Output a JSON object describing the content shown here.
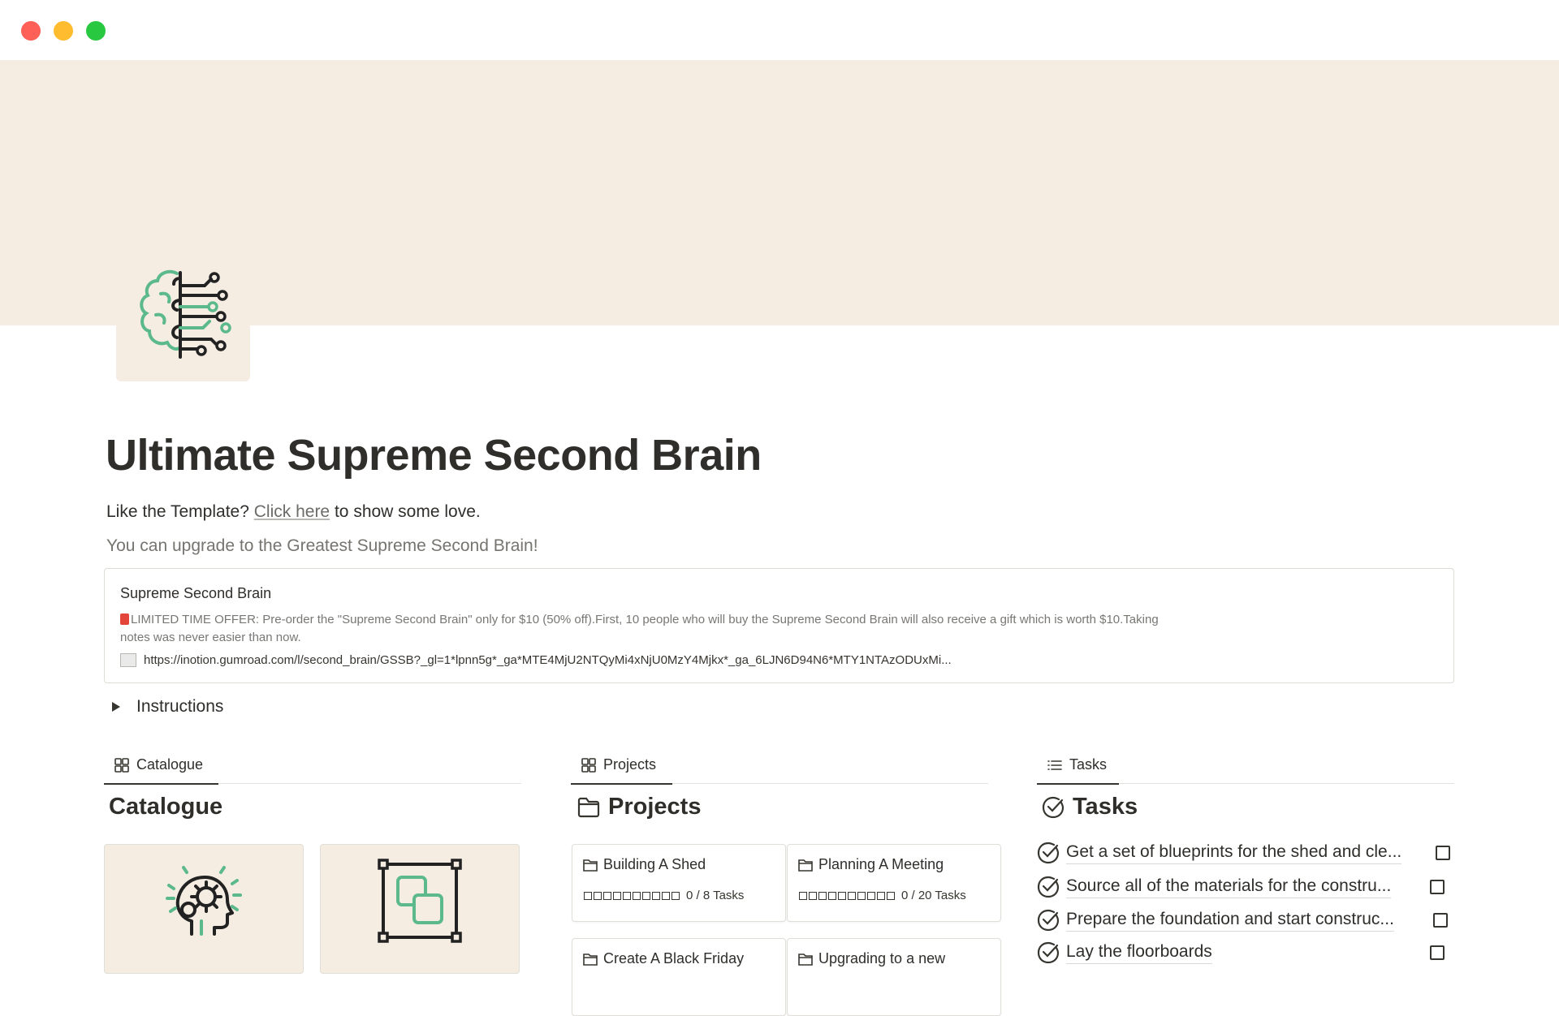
{
  "window": {
    "buttons": [
      "close",
      "minimize",
      "maximize"
    ]
  },
  "page": {
    "icon": "brain-circuit-icon",
    "title": "Ultimate Supreme Second Brain",
    "like_prefix": "Like the Template?",
    "like_link": "Click here",
    "like_suffix": "to show some love.",
    "upgrade_text": "You can upgrade to the Greatest Supreme Second Brain!"
  },
  "bookmark": {
    "title": "Supreme Second Brain",
    "description": "LIMITED TIME OFFER: Pre-order the \"Supreme Second Brain\" only for $10 (50% off).First, 10 people who will buy the Supreme Second Brain will also receive a gift which is worth $10.Taking notes was never easier than now.",
    "url": "https://inotion.gumroad.com/l/second_brain/GSSB?_gl=1*lpnn5g*_ga*MTE4MjU2NTQyMi4xNjU0MzY4Mjkx*_ga_6LJN6D94N6*MTY1NTAzODUxMi..."
  },
  "toggle": {
    "label": "Instructions"
  },
  "catalogue": {
    "tab": "Catalogue",
    "heading": "Catalogue",
    "cards": [
      {
        "icon": "gear-head-icon"
      },
      {
        "icon": "layers-frame-icon"
      }
    ]
  },
  "projects": {
    "tab": "Projects",
    "heading": "Projects",
    "items": [
      {
        "name": "Building A Shed",
        "progress": "0 / 8 Tasks",
        "done": 0,
        "total": 8
      },
      {
        "name": "Planning A Meeting",
        "progress": "0 / 20 Tasks",
        "done": 0,
        "total": 20
      },
      {
        "name": "Create A Black Friday"
      },
      {
        "name": "Upgrading to a new"
      }
    ]
  },
  "tasks": {
    "tab": "Tasks",
    "heading": "Tasks",
    "items": [
      {
        "text": "Get a set of blueprints for the shed and cle...",
        "checked": false
      },
      {
        "text": "Source all of the materials for the constru...",
        "checked": false
      },
      {
        "text": "Prepare the foundation and start construc...",
        "checked": false
      },
      {
        "text": "Lay the floorboards",
        "checked": false
      }
    ]
  },
  "colors": {
    "cover": "#f5ede2",
    "accent_green": "#5bb98c",
    "text": "#37352f"
  }
}
